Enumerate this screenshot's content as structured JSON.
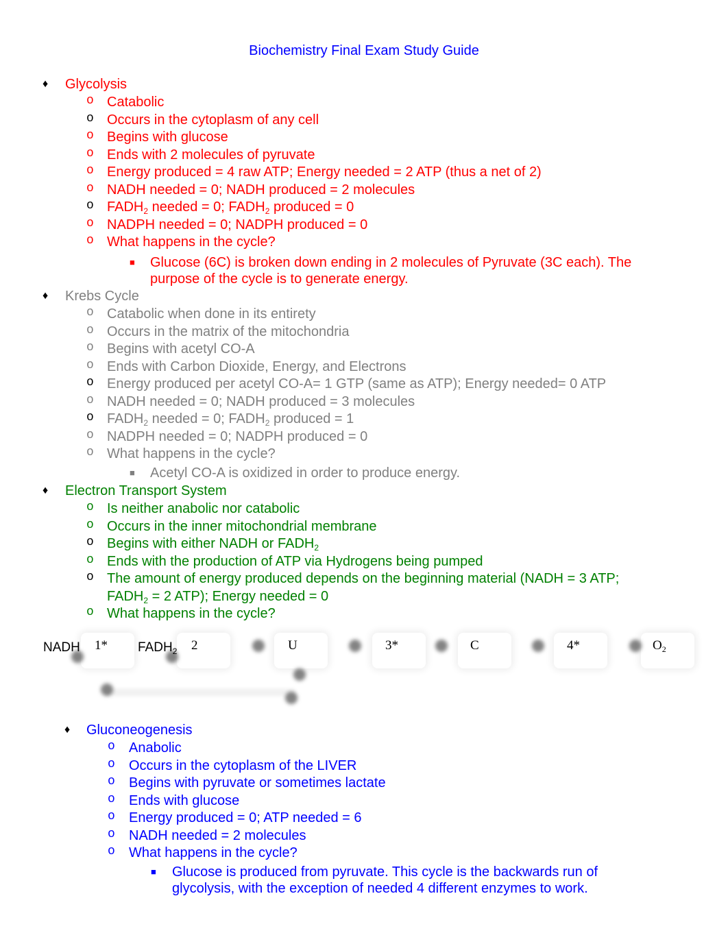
{
  "title": "Biochemistry Final Exam Study Guide",
  "colors": {
    "glycolysis": "#ff0000",
    "krebs": "#808080",
    "ets": "#008000",
    "gluconeogenesis": "#0000ff",
    "title": "#0000ff"
  },
  "glycolysis": {
    "heading": "Glycolysis",
    "items": [
      "Catabolic",
      "Occurs in the cytoplasm of any cell",
      "Begins with glucose",
      "Ends with 2 molecules of pyruvate",
      "Energy produced = 4 raw ATP; Energy needed = 2 ATP (thus a net of 2)",
      "NADH needed = 0; NADH produced = 2 molecules",
      {
        "a": "FADH",
        "b": " needed = 0; FADH",
        "c": " produced = 0"
      },
      "NADPH needed = 0; NADPH produced = 0",
      "What happens in the cycle?"
    ],
    "detail": "Glucose (6C) is broken down ending in 2 molecules of Pyruvate (3C each).  The purpose of the cycle is to generate energy."
  },
  "krebs": {
    "heading": "Krebs Cycle",
    "items": [
      "Catabolic when done in its entirety",
      "Occurs in the matrix of the mitochondria",
      "Begins with acetyl CO-A",
      "Ends with Carbon Dioxide, Energy, and Electrons",
      "Energy produced per acetyl CO-A= 1 GTP (same as ATP); Energy needed= 0 ATP",
      "NADH needed = 0; NADH produced = 3 molecules",
      {
        "a": "FADH",
        "b": " needed = 0; FADH",
        "c": " produced = 1"
      },
      "NADPH needed = 0; NADPH produced = 0",
      "What happens in the cycle?"
    ],
    "detail": "Acetyl CO-A is oxidized in order to produce energy."
  },
  "ets": {
    "heading": "Electron Transport System",
    "items": [
      "Is neither anabolic nor catabolic",
      "Occurs in the inner mitochondrial membrane",
      {
        "a": "Begins with either NADH or FADH",
        "b": ""
      },
      "Ends with the production of ATP via Hydrogens being pumped",
      {
        "a": "The amount of energy produced depends on the beginning material (NADH = 3 ATP; FADH",
        "b": " = 2 ATP); Energy needed = 0"
      },
      "What happens in the cycle?"
    ]
  },
  "diagram": {
    "labels": [
      "NADH",
      "1*",
      "FADH",
      "2",
      "U",
      "3*",
      "C",
      "4*",
      "O"
    ],
    "sub": "2"
  },
  "gluconeogenesis": {
    "heading": "Gluconeogenesis",
    "items": [
      "Anabolic",
      "Occurs in the cytoplasm of the LIVER",
      "Begins with pyruvate or sometimes lactate",
      "Ends with glucose",
      "Energy produced = 0;  ATP needed = 6",
      "NADH needed = 2 molecules",
      "What happens in the cycle?"
    ],
    "detail": "Glucose is produced from pyruvate.  This cycle is the backwards run of glycolysis, with the exception of needed 4 different enzymes to work."
  },
  "markers": {
    "level1": "♦",
    "level2": "o",
    "level3": "■"
  }
}
